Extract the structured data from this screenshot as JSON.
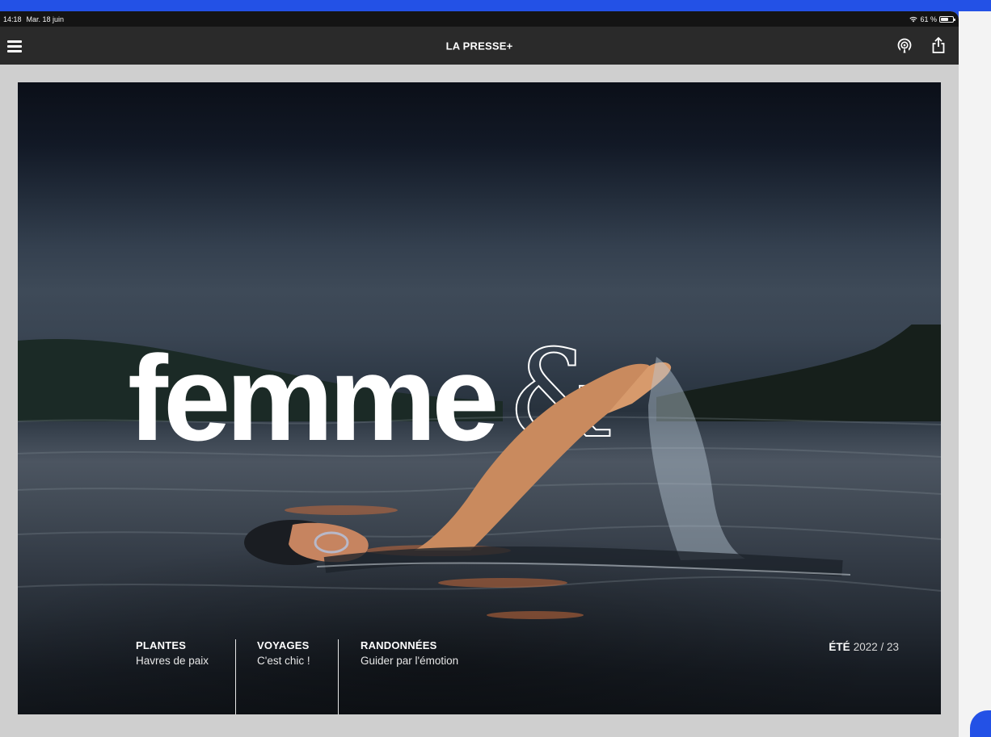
{
  "status_bar": {
    "time": "14:18",
    "date": "Mar. 18 juin",
    "battery": "61 %",
    "battery_level": 0.61
  },
  "app_bar": {
    "title": "LA PRESSE+",
    "menu_icon": "hamburger-menu-icon",
    "podcast_icon": "podcast-icon",
    "share_icon": "share-icon"
  },
  "cover": {
    "title": "femme",
    "title_amp": "&",
    "sections": [
      {
        "category": "PLANTES",
        "subtitle": "Havres de paix"
      },
      {
        "category": "VOYAGES",
        "subtitle": "C'est chic !"
      },
      {
        "category": "RANDONNÉES",
        "subtitle": "Guider par l'émotion"
      }
    ],
    "season_label": "ÉTÉ",
    "season_year": "2022 / 23"
  },
  "colors": {
    "app_bar": "#2a2a2a",
    "status_bar": "#141414",
    "content_bg": "#cfcfcf",
    "frame": "#2351e6"
  }
}
